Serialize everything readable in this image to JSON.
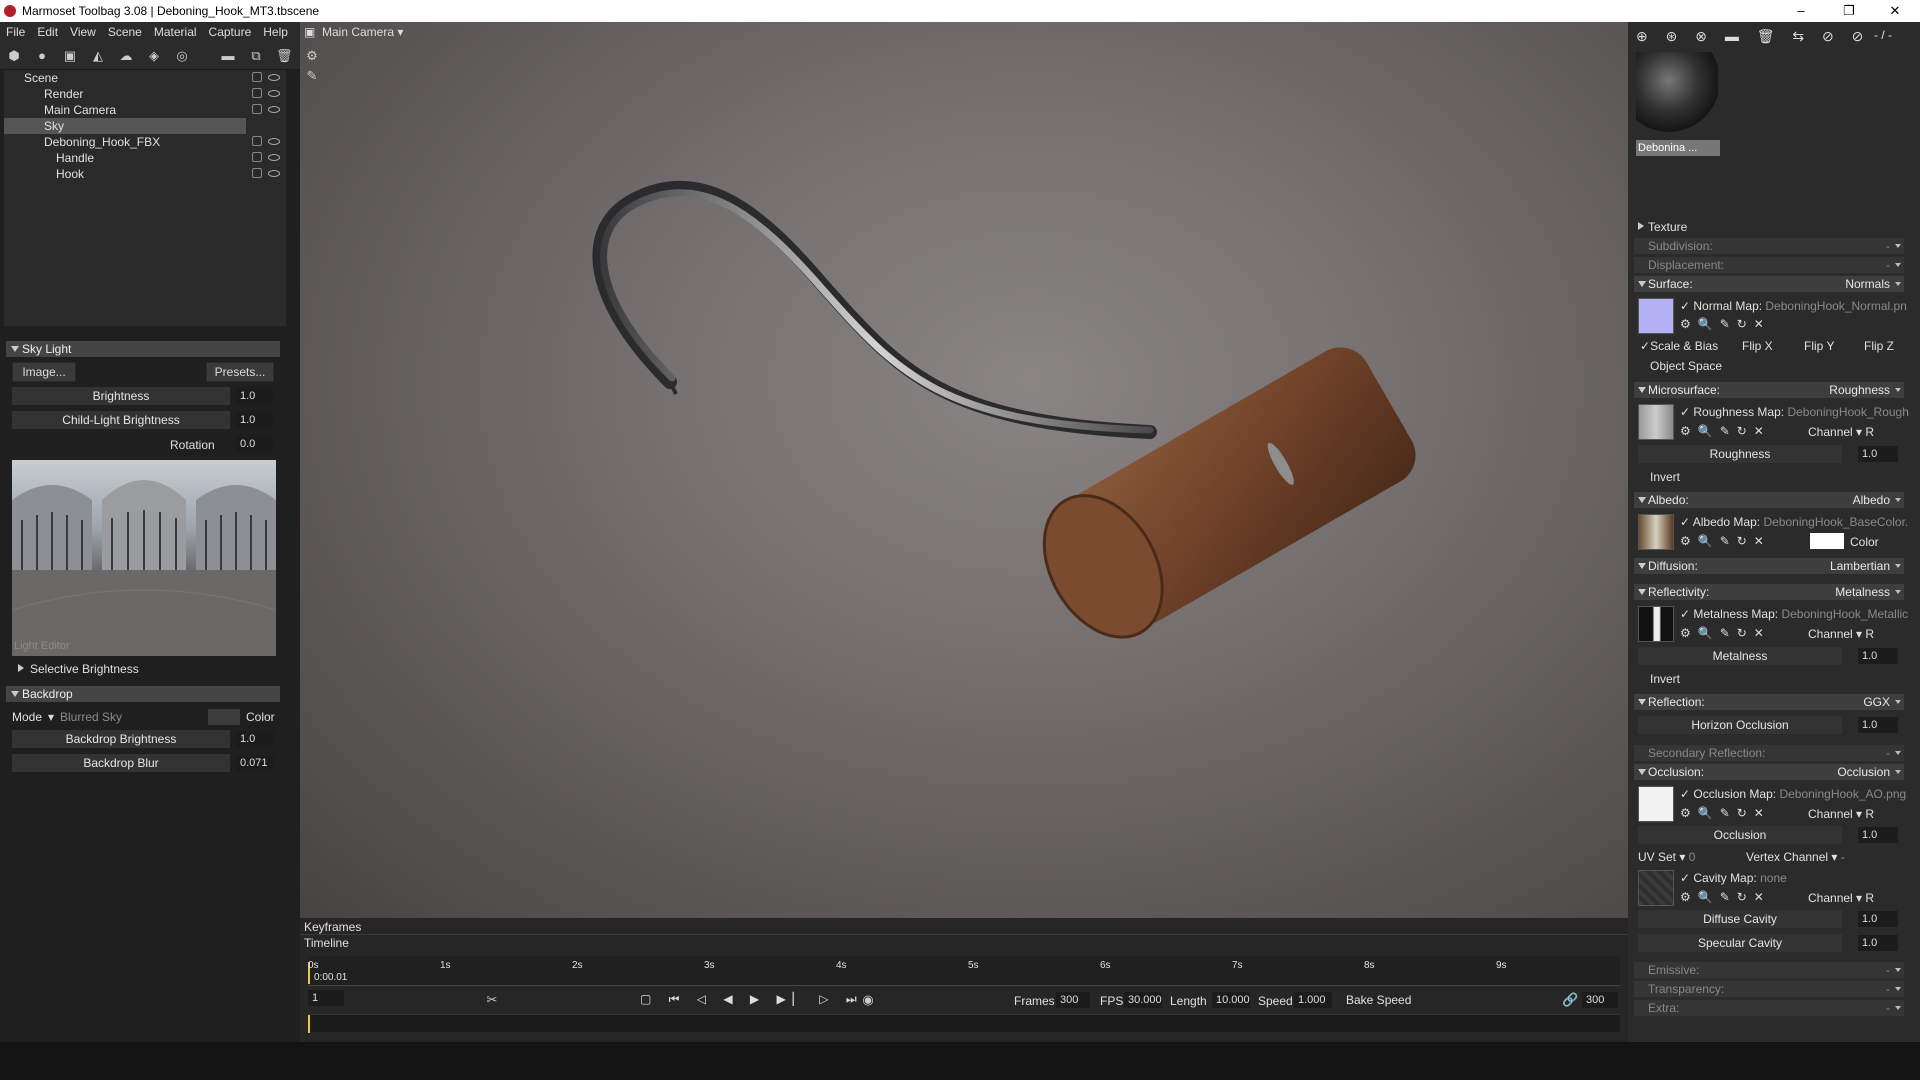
{
  "window": {
    "title": "Marmoset Toolbag 3.08  |  Deboning_Hook_MT3.tbscene",
    "min": "–",
    "max": "❐",
    "close": "✕"
  },
  "menu": [
    "File",
    "Edit",
    "View",
    "Scene",
    "Material",
    "Capture",
    "Help"
  ],
  "outliner": [
    {
      "label": "Scene",
      "indent": 0,
      "sel": false
    },
    {
      "label": "Render",
      "indent": 1,
      "sel": false
    },
    {
      "label": "Main Camera",
      "indent": 1,
      "sel": false
    },
    {
      "label": "Sky",
      "indent": 1,
      "sel": true
    },
    {
      "label": "Deboning_Hook_FBX",
      "indent": 1,
      "sel": false
    },
    {
      "label": "Handle",
      "indent": 2,
      "sel": false
    },
    {
      "label": "Hook",
      "indent": 2,
      "sel": false
    }
  ],
  "skylight": {
    "header": "Sky Light",
    "image_btn": "Image...",
    "presets_btn": "Presets...",
    "brightness_label": "Brightness",
    "brightness": "1.0",
    "child_label": "Child-Light Brightness",
    "child": "1.0",
    "rotation_label": "Rotation",
    "rotation": "0.0",
    "light_editor": "Light Editor",
    "selective": "Selective Brightness"
  },
  "backdrop": {
    "header": "Backdrop",
    "mode_label": "Mode",
    "mode_value": "Blurred Sky",
    "color_label": "Color",
    "brightness_label": "Backdrop Brightness",
    "brightness": "1.0",
    "blur_label": "Backdrop Blur",
    "blur": "0.071"
  },
  "viewport": {
    "camera": "Main Camera"
  },
  "timeline": {
    "keyframes": "Keyframes",
    "timeline": "Timeline",
    "current": "0:00.01",
    "ticks": [
      "0s",
      "1s",
      "2s",
      "3s",
      "4s",
      "5s",
      "6s",
      "7s",
      "8s",
      "9s"
    ],
    "frame": "1",
    "frames_label": "Frames",
    "frames": "300",
    "fps_label": "FPS",
    "fps": "30.000",
    "length_label": "Length",
    "length": "10.000",
    "speed_label": "Speed",
    "speed": "1.000",
    "bake": "Bake Speed",
    "end": "300"
  },
  "material": {
    "name": "Debonina ...",
    "toolbar_value": "- / -"
  },
  "sections": {
    "texture": "Texture",
    "subdivision": "Subdivision:",
    "displacement": "Displacement:",
    "surface": "Surface:",
    "surface_val": "Normals",
    "normal_map": "Normal Map:",
    "normal_file": "DeboningHook_Normal.pn",
    "scale_bias": "Scale & Bias",
    "flipx": "Flip X",
    "flipy": "Flip Y",
    "flipz": "Flip Z",
    "object_space": "Object Space",
    "micro": "Microsurface:",
    "micro_val": "Roughness",
    "rough_map": "Roughness Map:",
    "rough_file": "DeboningHook_Rough",
    "channel": "Channel",
    "channel_r": "R",
    "roughness": "Roughness",
    "roughness_val": "1.0",
    "invert": "Invert",
    "albedo": "Albedo:",
    "albedo_val": "Albedo",
    "albedo_map": "Albedo Map:",
    "albedo_file": "DeboningHook_BaseColor.",
    "color": "Color",
    "diffusion": "Diffusion:",
    "diffusion_val": "Lambertian",
    "reflectivity": "Reflectivity:",
    "reflectivity_val": "Metalness",
    "metal_map": "Metalness Map:",
    "metal_file": "DeboningHook_Metallic",
    "metalness": "Metalness",
    "metalness_val": "1.0",
    "reflection": "Reflection:",
    "reflection_val": "GGX",
    "horizon": "Horizon Occlusion",
    "horizon_val": "1.0",
    "secondary": "Secondary Reflection:",
    "occlusion": "Occlusion:",
    "occlusion_val": "Occlusion",
    "occ_map": "Occlusion Map:",
    "occ_file": "DeboningHook_AO.png",
    "occ": "Occlusion",
    "occ_val": "1.0",
    "uvset": "UV Set",
    "uvset_val": "0",
    "vertex_channel": "Vertex Channel",
    "vc_val": "-",
    "cavity_map": "Cavity Map:",
    "cavity_file": "none",
    "diffuse_cavity": "Diffuse Cavity",
    "dc_val": "1.0",
    "specular_cavity": "Specular Cavity",
    "sc_val": "1.0",
    "emissive": "Emissive:",
    "transparency": "Transparency:",
    "extra": "Extra:",
    "dash": "-"
  }
}
